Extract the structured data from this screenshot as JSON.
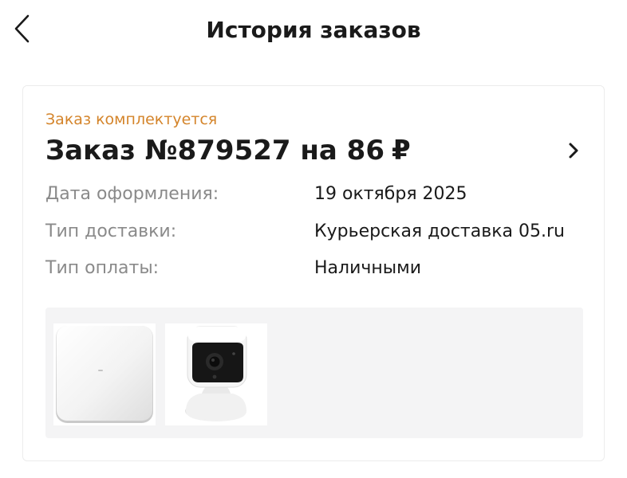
{
  "header": {
    "title": "История заказов",
    "back_icon": "chevron-left-icon"
  },
  "order": {
    "status": "Заказ комплектуется",
    "title_prefix": "Заказ №879527 на 86",
    "currency": "₽",
    "open_icon": "chevron-right-icon",
    "details": [
      {
        "label": "Дата оформления:",
        "value": "19 октября 2025"
      },
      {
        "label": "Тип доставки:",
        "value": "Курьерская доставка 05.ru"
      },
      {
        "label": "Тип оплаты:",
        "value": "Наличными"
      }
    ],
    "products": [
      {
        "icon": "smart-hub-image"
      },
      {
        "icon": "security-camera-image"
      }
    ]
  },
  "colors": {
    "status": "#d4842a",
    "label": "#8a8a8a",
    "text": "#1a1a1a",
    "strip_bg": "#f4f4f5",
    "card_border": "#ececec"
  }
}
